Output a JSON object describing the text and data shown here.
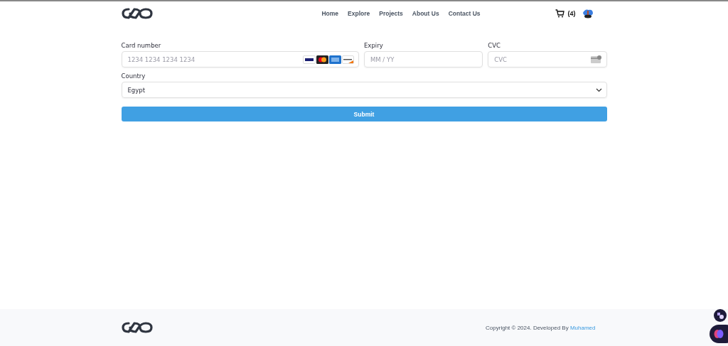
{
  "nav": {
    "links": [
      "Home",
      "Explore",
      "Projects",
      "About Us",
      "Contact Us"
    ],
    "cart_count": "(4)"
  },
  "form": {
    "card_number": {
      "label": "Card number",
      "placeholder": "1234 1234 1234 1234"
    },
    "expiry": {
      "label": "Expiry",
      "placeholder": "MM / YY"
    },
    "cvc": {
      "label": "CVC",
      "placeholder": "CVC"
    },
    "country": {
      "label": "Country",
      "value": "Egypt"
    },
    "submit": "Submit"
  },
  "footer": {
    "copyright": "Copyright © 2024. Developed By ",
    "author": "Muhamed"
  }
}
